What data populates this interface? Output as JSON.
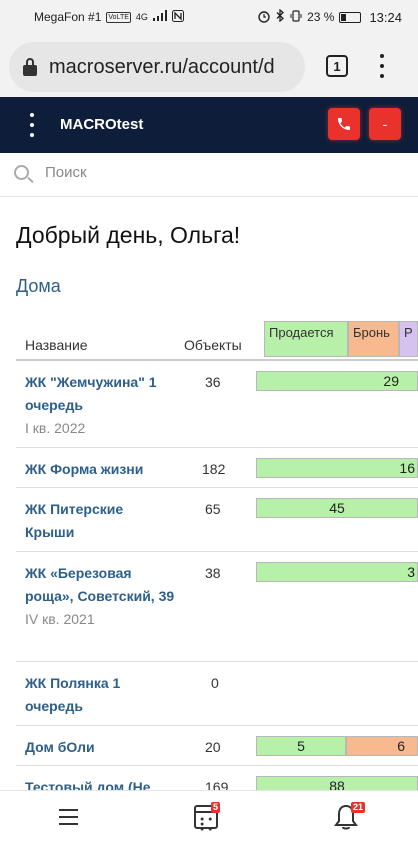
{
  "statusbar": {
    "carrier": "MegaFon #1",
    "net_badge": "VoLTE",
    "signal": "4G",
    "battery": "23 %",
    "time": "13:24"
  },
  "browser": {
    "url": "macroserver.ru/account/d",
    "tab_count": "1"
  },
  "app": {
    "title": "MACROtest",
    "call_icon": "phone-icon",
    "minus_label": "-"
  },
  "search": {
    "placeholder": "Поиск"
  },
  "main": {
    "greeting": "Добрый день, Ольга!",
    "section_title": "Дома",
    "columns": {
      "name": "Название",
      "objects": "Объекты",
      "sale": "Продается",
      "booked": "Бронь",
      "sold": "Р"
    },
    "colors": {
      "sale": "#b7f0a8",
      "booked": "#f8b98f",
      "sold": "#d6c2ef",
      "link": "#2d5f8a"
    },
    "rows": [
      {
        "name": "ЖК \"Жемчужина\" 1 очередь",
        "date": "I кв. 2022",
        "count": "36",
        "sale": "29"
      },
      {
        "name": "ЖК Форма жизни",
        "date": "",
        "count": "182",
        "sale": "16"
      },
      {
        "name": "ЖК Питерские Крыши",
        "date": "",
        "count": "65",
        "sale": "45"
      },
      {
        "name": "ЖК «Березовая роща», Советский, 39",
        "date": "IV кв. 2021",
        "count": "38",
        "sale": "3"
      },
      {
        "name": "ЖК Полянка 1 очередь",
        "date": "",
        "count": "0",
        "sale": ""
      },
      {
        "name": "Дом бОли",
        "date": "",
        "count": "20",
        "sale": "5",
        "booked": "6"
      },
      {
        "name": "Тестовый дом (Не",
        "date": "",
        "count": "169",
        "sale": "88"
      }
    ]
  },
  "bottomnav": {
    "calendar_badge": "5",
    "bell_badge": "21"
  }
}
